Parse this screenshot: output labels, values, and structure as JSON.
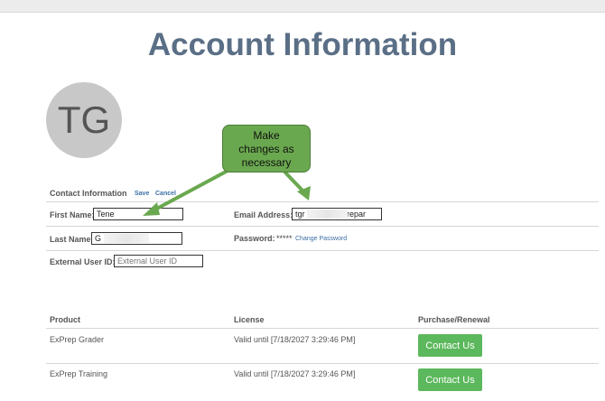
{
  "page": {
    "title": "Account Information"
  },
  "avatar": {
    "initials": "TG"
  },
  "contact": {
    "heading": "Contact Information",
    "save_label": "Save",
    "cancel_label": "Cancel",
    "first_name_label": "First Name:",
    "first_name_value": "Tene",
    "last_name_label": "Last Name:",
    "last_name_value": "G",
    "external_id_label": "External User ID:",
    "external_id_placeholder": "External User ID",
    "email_label": "Email Address:",
    "email_value": "tgr            celprepar",
    "password_label": "Password:",
    "password_value": "*****",
    "change_password_label": "Change Password"
  },
  "callout": {
    "lines": [
      "Make",
      "changes as",
      "necessary"
    ]
  },
  "products": {
    "headers": {
      "product": "Product",
      "license": "License",
      "purchase": "Purchase/Renewal"
    },
    "rows": [
      {
        "product": "ExPrep Grader",
        "license": "Valid until [7/18/2027 3:29:46 PM]",
        "button": "Contact Us"
      },
      {
        "product": "ExPrep Training",
        "license": "Valid until [7/18/2027 3:29:46 PM]",
        "button": "Contact Us"
      }
    ]
  },
  "colors": {
    "title": "#5a6f86",
    "button": "#5cb85c",
    "callout": "#6aa84f",
    "arrow": "#6aa84f",
    "link": "#3b6ea5"
  }
}
